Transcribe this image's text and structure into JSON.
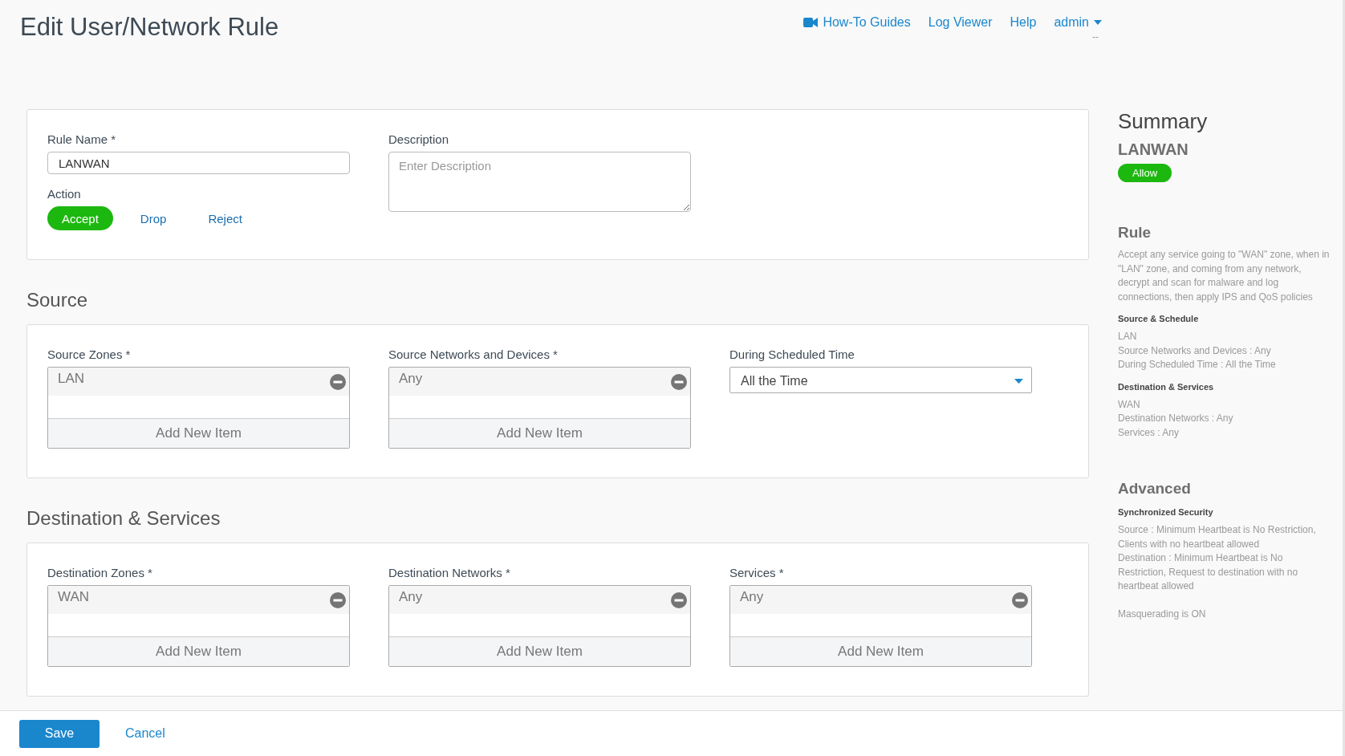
{
  "page_title": "Edit User/Network Rule",
  "nav": {
    "links": [
      {
        "label": "How-To Guides",
        "kind": "video"
      },
      {
        "label": "Log Viewer",
        "kind": "plain"
      },
      {
        "label": "Help",
        "kind": "plain"
      }
    ],
    "user": "admin",
    "user_subtitle": "--"
  },
  "general": {
    "rule_name": {
      "label": "Rule Name *",
      "value": "LANWAN"
    },
    "action": {
      "label": "Action",
      "options": [
        {
          "label": "Accept",
          "selected": true
        },
        {
          "label": "Drop",
          "selected": false
        },
        {
          "label": "Reject",
          "selected": false
        }
      ]
    },
    "description": {
      "label": "Description",
      "placeholder": "Enter Description"
    }
  },
  "sections": [
    {
      "heading": "Source",
      "fields": [
        {
          "kind": "list",
          "label": "Source Zones *",
          "items": [
            "LAN"
          ],
          "add_label": "Add New Item"
        },
        {
          "kind": "list",
          "label": "Source Networks and Devices *",
          "items": [
            "Any"
          ],
          "add_label": "Add New Item"
        },
        {
          "kind": "select",
          "label": "During Scheduled Time",
          "value": "All the Time"
        }
      ]
    },
    {
      "heading": "Destination & Services",
      "fields": [
        {
          "kind": "list",
          "label": "Destination Zones *",
          "items": [
            "WAN"
          ],
          "add_label": "Add New Item"
        },
        {
          "kind": "list",
          "label": "Destination Networks *",
          "items": [
            "Any"
          ],
          "add_label": "Add New Item"
        },
        {
          "kind": "list",
          "label": "Services *",
          "items": [
            "Any"
          ],
          "add_label": "Add New Item"
        }
      ]
    }
  ],
  "summary": {
    "title": "Summary",
    "name": "LANWAN",
    "badge": "Allow",
    "rule": {
      "heading": "Rule",
      "text": "Accept any service going to \"WAN\" zone, when in \"LAN\" zone, and coming from any network, decrypt and scan for malware and log connections, then apply IPS and QoS policies",
      "groups": [
        {
          "heading": "Source & Schedule",
          "lines": [
            "LAN",
            "Source Networks and Devices : Any",
            "During Scheduled Time : All the Time"
          ]
        },
        {
          "heading": "Destination & Services",
          "lines": [
            "WAN",
            "Destination Networks : Any",
            "Services : Any"
          ]
        }
      ]
    },
    "advanced": {
      "heading": "Advanced",
      "groups": [
        {
          "heading": "Synchronized Security",
          "lines": [
            "Source : Minimum Heartbeat is No Restriction, Clients with no heartbeat allowed",
            "Destination : Minimum Heartbeat is No Restriction, Request to destination with no heartbeat allowed"
          ]
        }
      ],
      "note": "Masquerading is ON"
    }
  },
  "footer": {
    "save": "Save",
    "cancel": "Cancel"
  }
}
